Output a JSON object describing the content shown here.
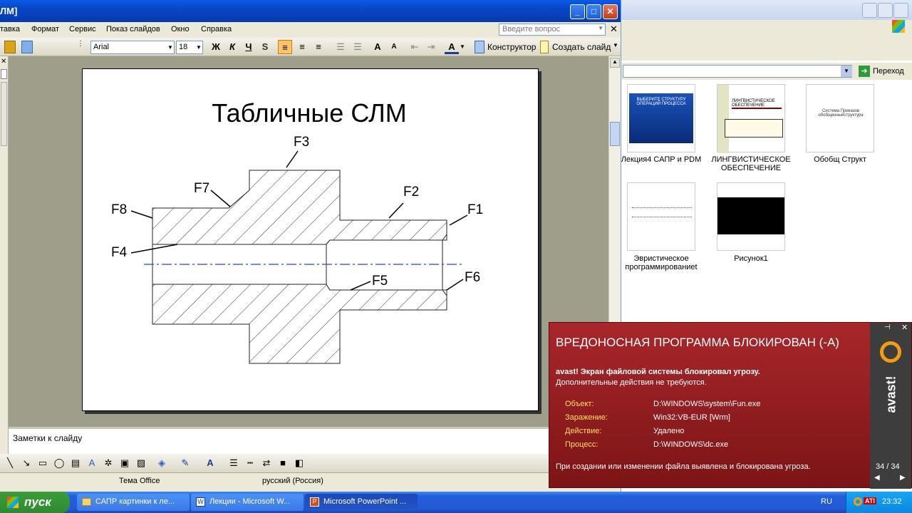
{
  "ppt": {
    "title": "ЛМ]",
    "menu": [
      "тавка",
      "Формат",
      "Сервис",
      "Показ слайдов",
      "Окно",
      "Справка"
    ],
    "help_placeholder": "Введите вопрос",
    "font_name": "Arial",
    "font_size": "18",
    "bold": "Ж",
    "italic": "К",
    "underline": "Ч",
    "shadow": "S",
    "constructor_label": "Конструктор",
    "new_slide_label": "Создать слайд",
    "notes_placeholder": "Заметки к слайду",
    "status_theme": "Тема Office",
    "status_lang": "русский (Россия)"
  },
  "slide": {
    "title": "Табличные СЛМ",
    "labels": [
      "F1",
      "F2",
      "F3",
      "F4",
      "F5",
      "F6",
      "F7",
      "F8"
    ]
  },
  "explorer": {
    "go_label": "Переход",
    "items": [
      {
        "label": "Лекция4 САПР и PDM"
      },
      {
        "label": "ЛИНГВИСТИЧЕСКОЕ ОБЕСПЕЧЕНИЕ"
      },
      {
        "label": "Обобщ Структ"
      },
      {
        "label": "Эвристическое программированиеt"
      },
      {
        "label": "Рисунок1"
      }
    ],
    "thumb_texts": {
      "t1": "ВЫБЕРИТЕ СТРУКТУРУ ОПЕРАЦИЙ ПРОЦЕССА",
      "t2": "ЛИНГВИСТИЧЕСКОЕ ОБЕСПЕЧЕНИЕ",
      "t3": "Система Приказов обобщенныйструктура"
    }
  },
  "avast": {
    "heading": "ВРЕДОНОСНАЯ ПРОГРАММА БЛОКИРОВАН (-А)",
    "line1": "avast! Экран файловой системы блокировал угрозу.",
    "line2": "Дополнительные действия не требуются.",
    "rows": [
      {
        "label": "Объект:",
        "value": "D:\\WINDOWS\\system\\Fun.exe"
      },
      {
        "label": "Заражение:",
        "value": "Win32:VB-EUR [Wrm]"
      },
      {
        "label": "Действие:",
        "value": "Удалено"
      },
      {
        "label": "Процесс:",
        "value": "D:\\WINDOWS\\dc.exe"
      }
    ],
    "footer": "При создании или изменении файла выявлена и блокирована угроза.",
    "counter": "34 / 34",
    "brand": "avast!"
  },
  "taskbar": {
    "start": "пуск",
    "tasks": [
      "САПР картинки к ле...",
      "Лекции - Microsoft W...",
      "Microsoft PowerPoint ..."
    ],
    "lang": "RU",
    "ati": "ATI",
    "time": "23:32"
  },
  "colors": {
    "xp_blue": "#0a5ae8",
    "avast_red": "#9a2023",
    "slide_bg": "#9f9e8b",
    "centerline": "#1f4fb5"
  }
}
